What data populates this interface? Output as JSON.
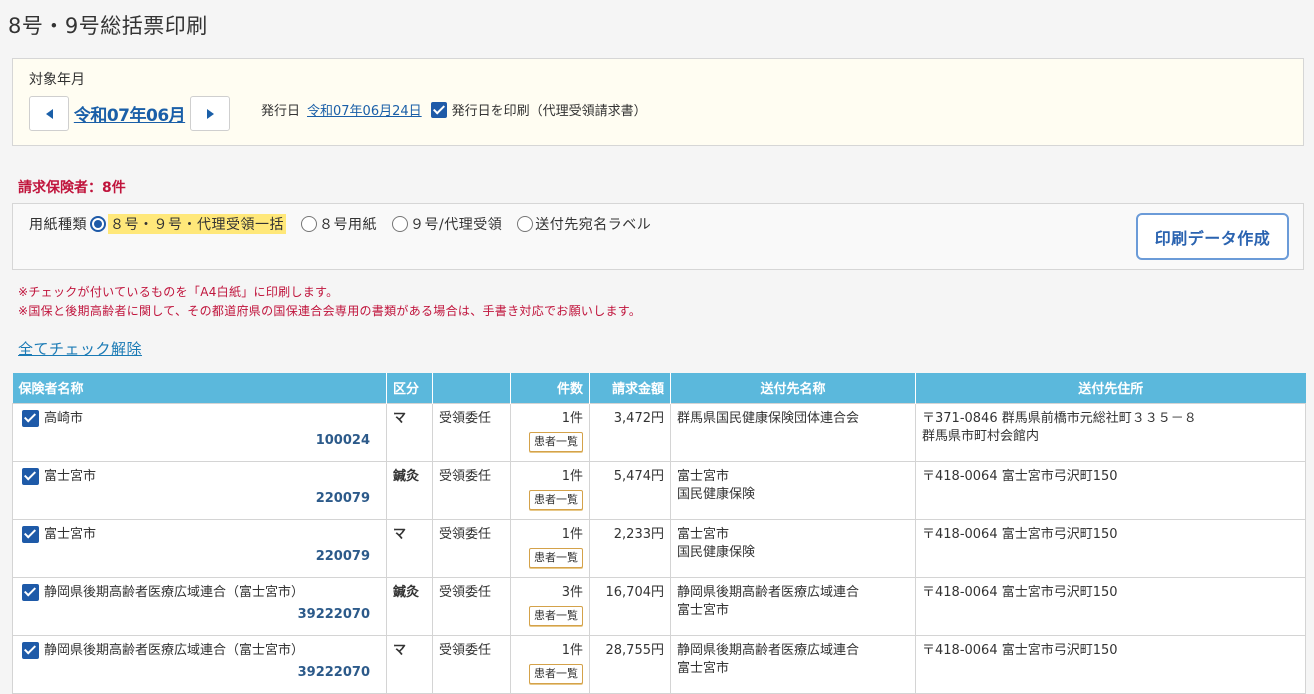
{
  "page_title": "8号・9号総括票印刷",
  "target_month": {
    "label": "対象年月",
    "value": "令和07年06月",
    "issue_label": "発行日",
    "issue_date": "令和07年06月24日",
    "print_issue_date_label": "発行日を印刷（代理受領請求書）",
    "print_issue_date_checked": true
  },
  "insurer_count_label": "請求保険者：8件",
  "paper": {
    "label": "用紙種類",
    "options": [
      {
        "label": "８号・９号・代理受領一括",
        "selected": true
      },
      {
        "label": "８号用紙",
        "selected": false
      },
      {
        "label": "９号/代理受領",
        "selected": false
      },
      {
        "label": "送付先宛名ラベル",
        "selected": false
      }
    ],
    "print_button": "印刷データ作成"
  },
  "notes": [
    "※チェックが付いているものを「A4白紙」に印刷します。",
    "※国保と後期高齢者に関して、その都道府県の国保連合会専用の書類がある場合は、手書き対応でお願いします。"
  ],
  "uncheck_all_link": "全てチェック解除",
  "table": {
    "headers": {
      "name": "保険者名称",
      "kubun": "区分",
      "type": "",
      "count": "件数",
      "amount": "請求金額",
      "dest_name": "送付先名称",
      "dest_address": "送付先住所"
    },
    "patient_list_label": "患者一覧",
    "rows": [
      {
        "checked": true,
        "name": "高崎市",
        "code": "100024",
        "kubun": "マ",
        "type": "受領委任",
        "count": "1件",
        "amount": "3,472円",
        "dest_name_1": "群馬県国民健康保険団体連合会",
        "dest_name_2": "",
        "address_1": "〒371-0846 群馬県前橋市元総社町３３５－８",
        "address_2": "群馬県市町村会館内"
      },
      {
        "checked": true,
        "name": "富士宮市",
        "code": "220079",
        "kubun": "鍼灸",
        "type": "受領委任",
        "count": "1件",
        "amount": "5,474円",
        "dest_name_1": "富士宮市",
        "dest_name_2": "国民健康保険",
        "address_1": "〒418-0064 富士宮市弓沢町150",
        "address_2": ""
      },
      {
        "checked": true,
        "name": "富士宮市",
        "code": "220079",
        "kubun": "マ",
        "type": "受領委任",
        "count": "1件",
        "amount": "2,233円",
        "dest_name_1": "富士宮市",
        "dest_name_2": "国民健康保険",
        "address_1": "〒418-0064 富士宮市弓沢町150",
        "address_2": ""
      },
      {
        "checked": true,
        "name": "静岡県後期高齢者医療広域連合（富士宮市）",
        "code": "39222070",
        "kubun": "鍼灸",
        "type": "受領委任",
        "count": "3件",
        "amount": "16,704円",
        "dest_name_1": "静岡県後期高齢者医療広域連合",
        "dest_name_2": "富士宮市",
        "address_1": "〒418-0064 富士宮市弓沢町150",
        "address_2": ""
      },
      {
        "checked": true,
        "name": "静岡県後期高齢者医療広域連合（富士宮市）",
        "code": "39222070",
        "kubun": "マ",
        "type": "受領委任",
        "count": "1件",
        "amount": "28,755円",
        "dest_name_1": "静岡県後期高齢者医療広域連合",
        "dest_name_2": "富士宮市",
        "address_1": "〒418-0064 富士宮市弓沢町150",
        "address_2": ""
      }
    ]
  },
  "icons": [
    "chevron-left-icon",
    "chevron-right-icon",
    "checkbox-icon",
    "radio-icon"
  ],
  "colors": {
    "accent": "#1e5aa8",
    "header_bg": "#5bb8dc",
    "alert": "#c0143c",
    "highlight": "#ffe87a"
  }
}
